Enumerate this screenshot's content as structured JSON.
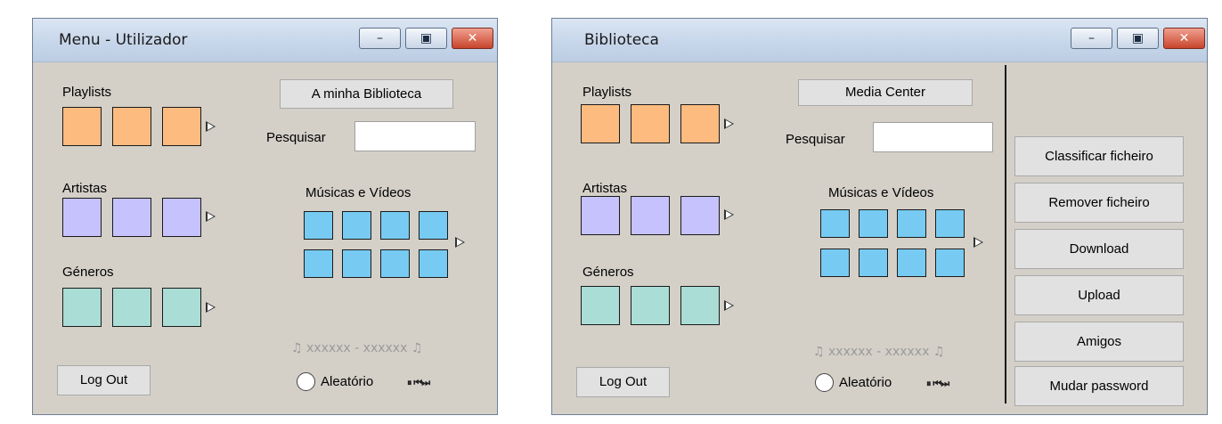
{
  "window1": {
    "title": "Menu - Utilizador",
    "buttons": {
      "minimize": "–",
      "maximize": "▣",
      "close": "✕"
    },
    "sections": {
      "playlists": "Playlists",
      "artists": "Artistas",
      "genres": "Géneros",
      "media": "Músicas e Vídeos"
    },
    "library_button": "A minha Biblioteca",
    "search_label": "Pesquisar",
    "search_value": "",
    "now_playing": "♫ xxxxxx - xxxxxx ♫",
    "shuffle_label": "Aleatório",
    "player_controls": "⏸ ⏮⏭",
    "logout": "Log Out"
  },
  "window2": {
    "title": "Biblioteca",
    "buttons": {
      "minimize": "–",
      "maximize": "▣",
      "close": "✕"
    },
    "sections": {
      "playlists": "Playlists",
      "artists": "Artistas",
      "genres": "Géneros",
      "media": "Músicas e Vídeos"
    },
    "media_center_button": "Media Center",
    "search_label": "Pesquisar",
    "search_value": "",
    "now_playing": "♫ xxxxxx - xxxxxx ♫",
    "shuffle_label": "Aleatório",
    "player_controls": "⏸ ⏮⏭",
    "logout": "Log Out",
    "actions": [
      "Classificar ficheiro",
      "Remover ficheiro",
      "Download",
      "Upload",
      "Amigos",
      "Mudar password"
    ]
  },
  "colors": {
    "playlist_tile": "#fdbb7f",
    "artist_tile": "#c6c2fd",
    "genre_tile": "#a9ddd6",
    "media_tile": "#77cbf2",
    "window_bg": "#d4d0c8"
  }
}
